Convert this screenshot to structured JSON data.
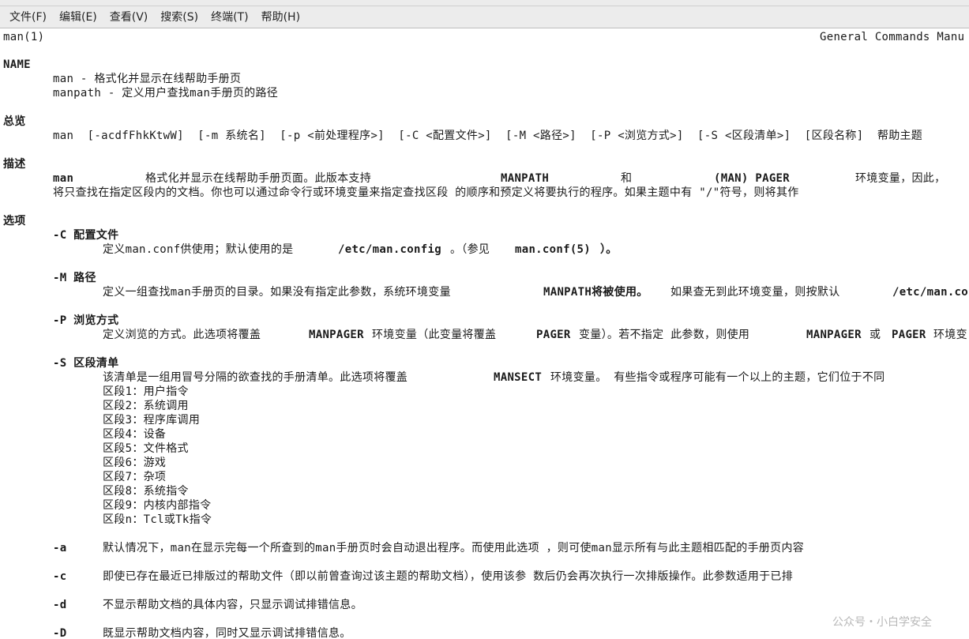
{
  "menu": [
    "文件(F)",
    "编辑(E)",
    "查看(V)",
    "搜索(S)",
    "终端(T)",
    "帮助(H)"
  ],
  "header": {
    "left": "man(1)",
    "right": "General Commands Manu"
  },
  "name_section": {
    "title": "NAME",
    "line1": "man - 格式化并显示在线帮助手册页",
    "line2": "manpath - 定义用户查找man手册页的路径"
  },
  "synopsis": {
    "title": "总览",
    "line": "man  [-acdfFhkKtwW]  [-m 系统名]  [-p <前处理程序>]  [-C <配置文件>]  [-M <路径>]  [-P <浏览方式>]  [-S <区段清单>]  [区段名称]  帮助主题"
  },
  "description": {
    "title": "描述",
    "l1_man": "man",
    "l1_a": "格式化并显示在线帮助手册页面。此版本支持",
    "l1_manpath": "MANPATH",
    "l1_and": "和",
    "l1_pager": "(MAN) PAGER",
    "l1_b": "环境变量，因此，",
    "line2": "将只查找在指定区段内的文档。你也可以通过命令行或环境变量来指定查找区段 的顺序和预定义将要执行的程序。如果主题中有 \"/\"符号，则将其作"
  },
  "options": {
    "title": "选项",
    "C": {
      "flag": "-C 配置文件",
      "t1": "定义man.conf供使用；默认使用的是",
      "path": "/etc/man.config",
      "t2": "。（参见",
      "ref": "man.conf(5)",
      "t3": "）。"
    },
    "M": {
      "flag": "-M 路径",
      "t1": "定义一组查找man手册页的目录。如果没有指定此参数，系统环境变量",
      "bold": "MANPATH将被使用。",
      "t2": "如果查无到此环境变量，则按默认",
      "path": "/etc/man.co"
    },
    "P": {
      "flag": "-P 浏览方式",
      "t1": "定义浏览的方式。此选项将覆盖",
      "manpager": "MANPAGER",
      "t2": "环境变量（此变量将覆盖",
      "pager": "PAGER",
      "t3": "变量）。若不指定 此参数，则使用",
      "manpager2": "MANPAGER",
      "or": "或",
      "pager2": "PAGER",
      "t4": "环境变"
    },
    "S": {
      "flag": "-S 区段清单",
      "t1": "该清单是一组用冒号分隔的欲查找的手册清单。此选项将覆盖",
      "mansect": "MANSECT",
      "t2": "环境变量。 有些指令或程序可能有一个以上的主题，它们位于不同"
    },
    "sections": [
      "区段1：用户指令",
      "区段2：系统调用",
      "区段3：程序库调用",
      "区段4：设备",
      "区段5：文件格式",
      "区段6：游戏",
      "区段7：杂项",
      "区段8：系统指令",
      "区段9：内核内部指令",
      "区段n：Tcl或Tk指令"
    ],
    "a": {
      "flag": "-a",
      "text": "默认情况下，man在显示完每一个所查到的man手册页时会自动退出程序。而使用此选项 ，则可使man显示所有与此主题相匹配的手册页内容"
    },
    "c": {
      "flag": "-c",
      "text": "即使已存在最近已排版过的帮助文件（即以前曾查询过该主题的帮助文档），使用该参 数后仍会再次执行一次排版操作。此参数适用于已排"
    },
    "d": {
      "flag": "-d",
      "text": "不显示帮助文档的具体内容，只显示调试排错信息。"
    },
    "D": {
      "flag": "-D",
      "text": "既显示帮助文档内容，同时又显示调试排错信息。"
    }
  },
  "watermark": "公众号・小白学安全"
}
